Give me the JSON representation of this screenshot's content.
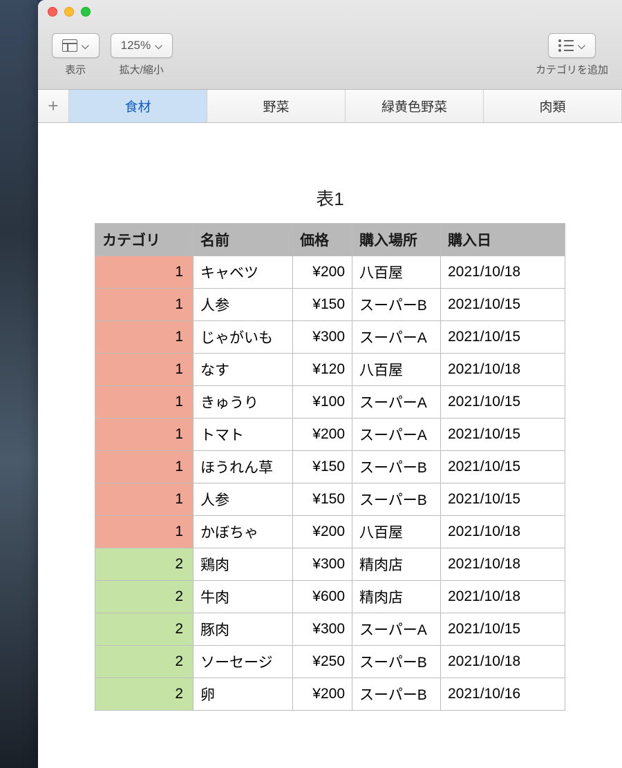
{
  "toolbar": {
    "view_label": "表示",
    "zoom_value": "125%",
    "zoom_label": "拡大/縮小",
    "add_category_label": "カテゴリを追加"
  },
  "sheets": {
    "tabs": [
      {
        "label": "食材",
        "active": true
      },
      {
        "label": "野菜",
        "active": false
      },
      {
        "label": "緑黄色野菜",
        "active": false
      },
      {
        "label": "肉類",
        "active": false
      }
    ]
  },
  "table": {
    "title": "表1",
    "headers": [
      "カテゴリ",
      "名前",
      "価格",
      "購入場所",
      "購入日"
    ],
    "rows": [
      {
        "category": 1,
        "name": "キャベツ",
        "price": "¥200",
        "place": "八百屋",
        "date": "2021/10/18"
      },
      {
        "category": 1,
        "name": "人参",
        "price": "¥150",
        "place": "スーパーB",
        "date": "2021/10/15"
      },
      {
        "category": 1,
        "name": "じゃがいも",
        "price": "¥300",
        "place": "スーパーA",
        "date": "2021/10/15"
      },
      {
        "category": 1,
        "name": "なす",
        "price": "¥120",
        "place": "八百屋",
        "date": "2021/10/18"
      },
      {
        "category": 1,
        "name": "きゅうり",
        "price": "¥100",
        "place": "スーパーA",
        "date": "2021/10/15"
      },
      {
        "category": 1,
        "name": "トマト",
        "price": "¥200",
        "place": "スーパーA",
        "date": "2021/10/15"
      },
      {
        "category": 1,
        "name": "ほうれん草",
        "price": "¥150",
        "place": "スーパーB",
        "date": "2021/10/15"
      },
      {
        "category": 1,
        "name": "人参",
        "price": "¥150",
        "place": "スーパーB",
        "date": "2021/10/15"
      },
      {
        "category": 1,
        "name": "かぼちゃ",
        "price": "¥200",
        "place": "八百屋",
        "date": "2021/10/18"
      },
      {
        "category": 2,
        "name": "鶏肉",
        "price": "¥300",
        "place": "精肉店",
        "date": "2021/10/18"
      },
      {
        "category": 2,
        "name": "牛肉",
        "price": "¥600",
        "place": "精肉店",
        "date": "2021/10/18"
      },
      {
        "category": 2,
        "name": "豚肉",
        "price": "¥300",
        "place": "スーパーA",
        "date": "2021/10/15"
      },
      {
        "category": 2,
        "name": "ソーセージ",
        "price": "¥250",
        "place": "スーパーB",
        "date": "2021/10/18"
      },
      {
        "category": 2,
        "name": "卵",
        "price": "¥200",
        "place": "スーパーB",
        "date": "2021/10/16"
      }
    ]
  },
  "category_colors": {
    "1": "cat-1",
    "2": "cat-2"
  }
}
